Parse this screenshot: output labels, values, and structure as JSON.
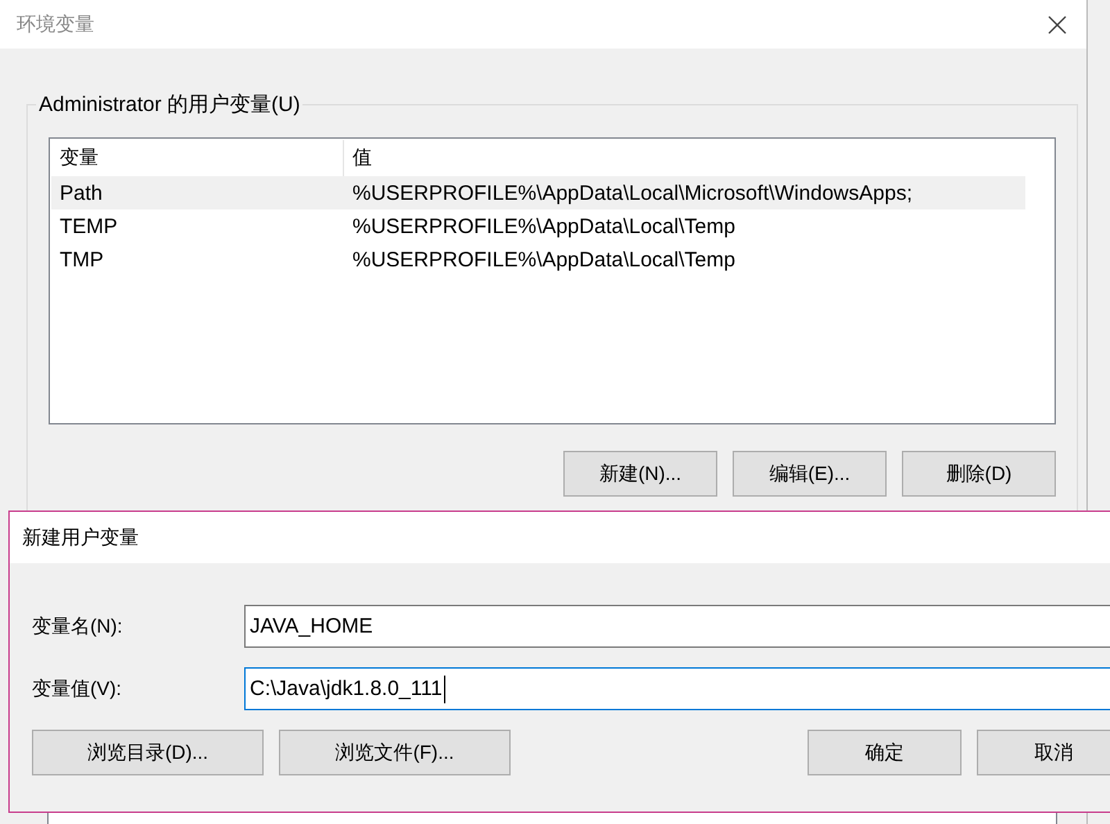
{
  "window": {
    "title": "环境变量"
  },
  "user_variables": {
    "label": "Administrator 的用户变量(U)",
    "columns": [
      "变量",
      "值"
    ],
    "rows": [
      {
        "name": "Path",
        "value": "%USERPROFILE%\\AppData\\Local\\Microsoft\\WindowsApps;",
        "selected": true
      },
      {
        "name": "TEMP",
        "value": "%USERPROFILE%\\AppData\\Local\\Temp",
        "selected": false
      },
      {
        "name": "TMP",
        "value": "%USERPROFILE%\\AppData\\Local\\Temp",
        "selected": false
      }
    ],
    "buttons": [
      "新建(N)...",
      "编辑(E)...",
      "删除(D)"
    ]
  },
  "dialog": {
    "title": "新建用户变量",
    "fields": [
      {
        "label": "变量名(N):",
        "value": "JAVA_HOME",
        "focused": false
      },
      {
        "label": "变量值(V):",
        "value": "C:\\Java\\jdk1.8.0_111",
        "focused": true
      }
    ],
    "left_buttons": [
      "浏览目录(D)...",
      "浏览文件(F)..."
    ],
    "right_buttons": [
      "确定",
      "取消"
    ]
  }
}
